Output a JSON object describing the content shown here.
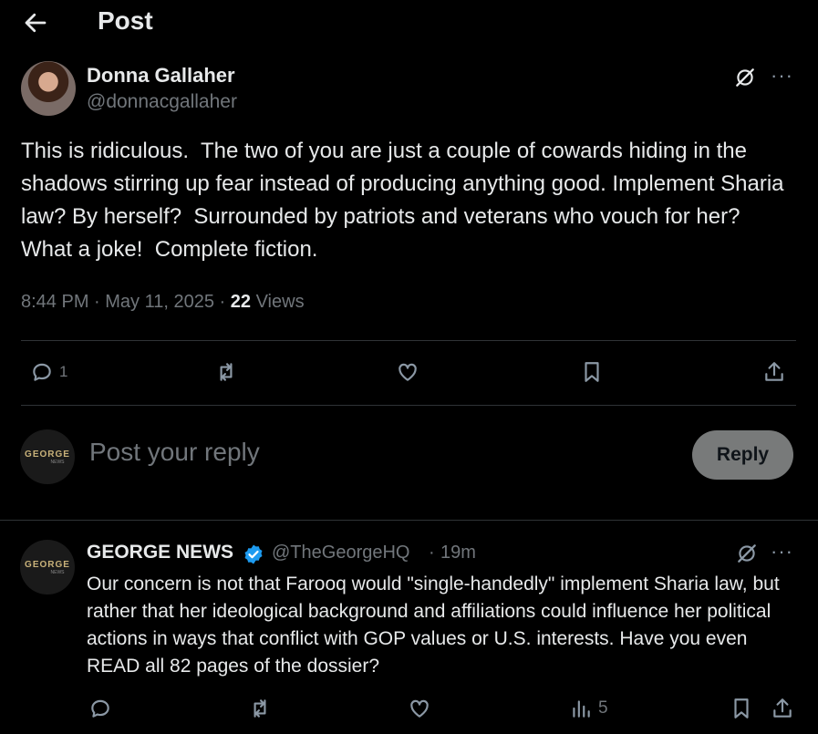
{
  "header": {
    "title": "Post"
  },
  "post": {
    "author_name": "Donna Gallaher",
    "author_handle": "@donnacgallaher",
    "text": "This is ridiculous.  The two of you are just a couple of cowards hiding in the shadows stirring up fear instead of producing anything good. Implement Sharia law? By herself?  Surrounded by patriots and veterans who vouch for her?  What a joke!  Complete fiction.",
    "time": "8:44 PM",
    "date": "May 11, 2025",
    "views_count": "22",
    "views_label": "Views",
    "reply_count": "1"
  },
  "composer": {
    "avatar_text": "GEORGE",
    "avatar_subtext": "NEWS",
    "placeholder": "Post your reply",
    "button_label": "Reply"
  },
  "reply": {
    "avatar_text": "GEORGE",
    "avatar_subtext": "NEWS",
    "author_name": "GEORGE NEWS",
    "author_handle": "@TheGeorgeHQ",
    "time": "19m",
    "text": "Our concern is not that Farooq would \"single-handedly\" implement Sharia law, but rather that her ideological background and affiliations could influence her political actions in ways that conflict with GOP values or U.S. interests. Have you even READ all 82 pages of the dossier?",
    "views_count": "5"
  },
  "icons": {
    "back": "arrow-left-icon",
    "grok": "grok-icon",
    "more": "more-icon",
    "reply": "reply-icon",
    "repost": "repost-icon",
    "like": "like-icon",
    "bookmark": "bookmark-icon",
    "share": "share-icon",
    "views": "views-icon",
    "verified": "verified-badge-icon"
  },
  "colors": {
    "background": "#000000",
    "text": "#e7e9ea",
    "secondary": "#71767b",
    "verified": "#1d9bf0",
    "reply_button": "#787a7a"
  }
}
